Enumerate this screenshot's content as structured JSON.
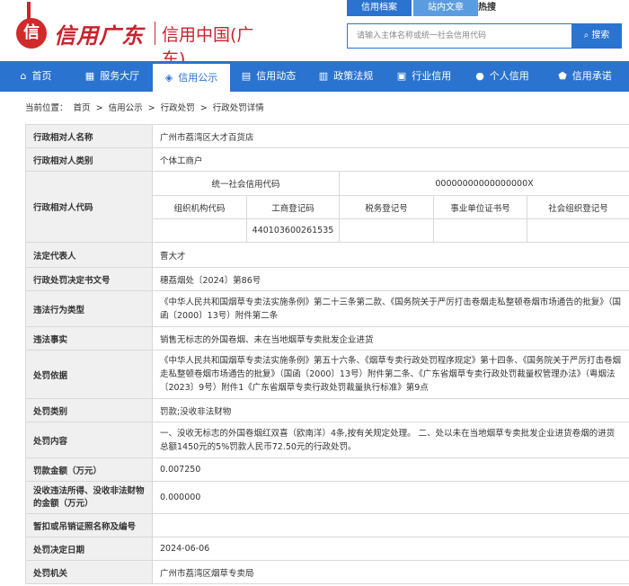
{
  "header": {
    "logo_emblem": "信",
    "logo_cn": "信用广东",
    "logo_sub": "信用中国(广东)",
    "top_tabs": [
      "信用档案",
      "站内文章"
    ],
    "hot_label": "热搜",
    "search_placeholder": "请输入主体名称或统一社会信用代码",
    "search_button": "搜索"
  },
  "nav": {
    "items": [
      {
        "icon": "home-icon",
        "glyph": "⌂",
        "label": "首页"
      },
      {
        "icon": "grid-icon",
        "glyph": "▦",
        "label": "服务大厅"
      },
      {
        "icon": "megaphone-icon",
        "glyph": "◈",
        "label": "信用公示"
      },
      {
        "icon": "document-icon",
        "glyph": "▤",
        "label": "信用动态"
      },
      {
        "icon": "book-icon",
        "glyph": "▥",
        "label": "政策法规"
      },
      {
        "icon": "building-icon",
        "glyph": "▣",
        "label": "行业信用"
      },
      {
        "icon": "person-icon",
        "glyph": "●",
        "label": "个人信用"
      },
      {
        "icon": "shield-icon",
        "glyph": "⬟",
        "label": "信用承诺"
      }
    ],
    "active_index": 2
  },
  "breadcrumb": {
    "prefix": "当前位置：",
    "items": [
      "首页",
      "信用公示",
      "行政处罚",
      "行政处罚详情"
    ],
    "separator": ">"
  },
  "detail": {
    "name_label": "行政相对人名称",
    "name_value": "广州市荔湾区大才百货店",
    "type_label": "行政相对人类别",
    "type_value": "个体工商户",
    "code_label": "行政相对人代码",
    "code_sub_label": "统一社会信用代码",
    "code_sub_value": "00000000000000000X",
    "code_cols": [
      "组织机构代码",
      "工商登记码",
      "税务登记号",
      "事业单位证书号",
      "社会组织登记号"
    ],
    "code_vals": [
      "",
      "440103600261535",
      "",
      "",
      ""
    ],
    "rep_label": "法定代表人",
    "rep_value": "曹大才",
    "doc_label": "行政处罚决定书文号",
    "doc_value": "穗荔烟处〔2024〕第86号",
    "violation_type_label": "违法行为类型",
    "violation_type_value": "《中华人民共和国烟草专卖法实施条例》第二十三条第二款、《国务院关于严厉打击卷烟走私整顿卷烟市场通告的批复》（国函〔2000〕13号）附件第二条",
    "facts_label": "违法事实",
    "facts_value": "销售无标志的外国卷烟、未在当地烟草专卖批发企业进货",
    "basis_label": "处罚依据",
    "basis_value": "《中华人民共和国烟草专卖法实施条例》第五十六条、《烟草专卖行政处罚程序规定》第十四条、《国务院关于严厉打击卷烟走私整顿卷烟市场通告的批复》（国函〔2000〕13号）附件第二条、《广东省烟草专卖行政处罚裁量权管理办法》（粤烟法〔2023〕9号）附件1《广东省烟草专卖行政处罚裁量执行标准》第9点",
    "category_label": "处罚类别",
    "category_value": "罚款;没收非法财物",
    "content_label": "处罚内容",
    "content_value": "一、没收无标志的外国卷烟红双喜（欧南洋）4条,按有关规定处理。 二、处以未在当地烟草专卖批发企业进货卷烟的进货总额1450元的5%罚款人民币72.50元的行政处罚。",
    "fine_label": "罚款金额（万元）",
    "fine_value": "0.007250",
    "confiscate_label": "没收违法所得、没收非法财物的金额（万元）",
    "confiscate_value": "0.000000",
    "license_label": "暂扣或吊销证照名称及编号",
    "license_value": "",
    "date_label": "处罚决定日期",
    "date_value": "2024-06-06",
    "org_label": "处罚机关",
    "org_value": "广州市荔湾区烟草专卖局"
  }
}
